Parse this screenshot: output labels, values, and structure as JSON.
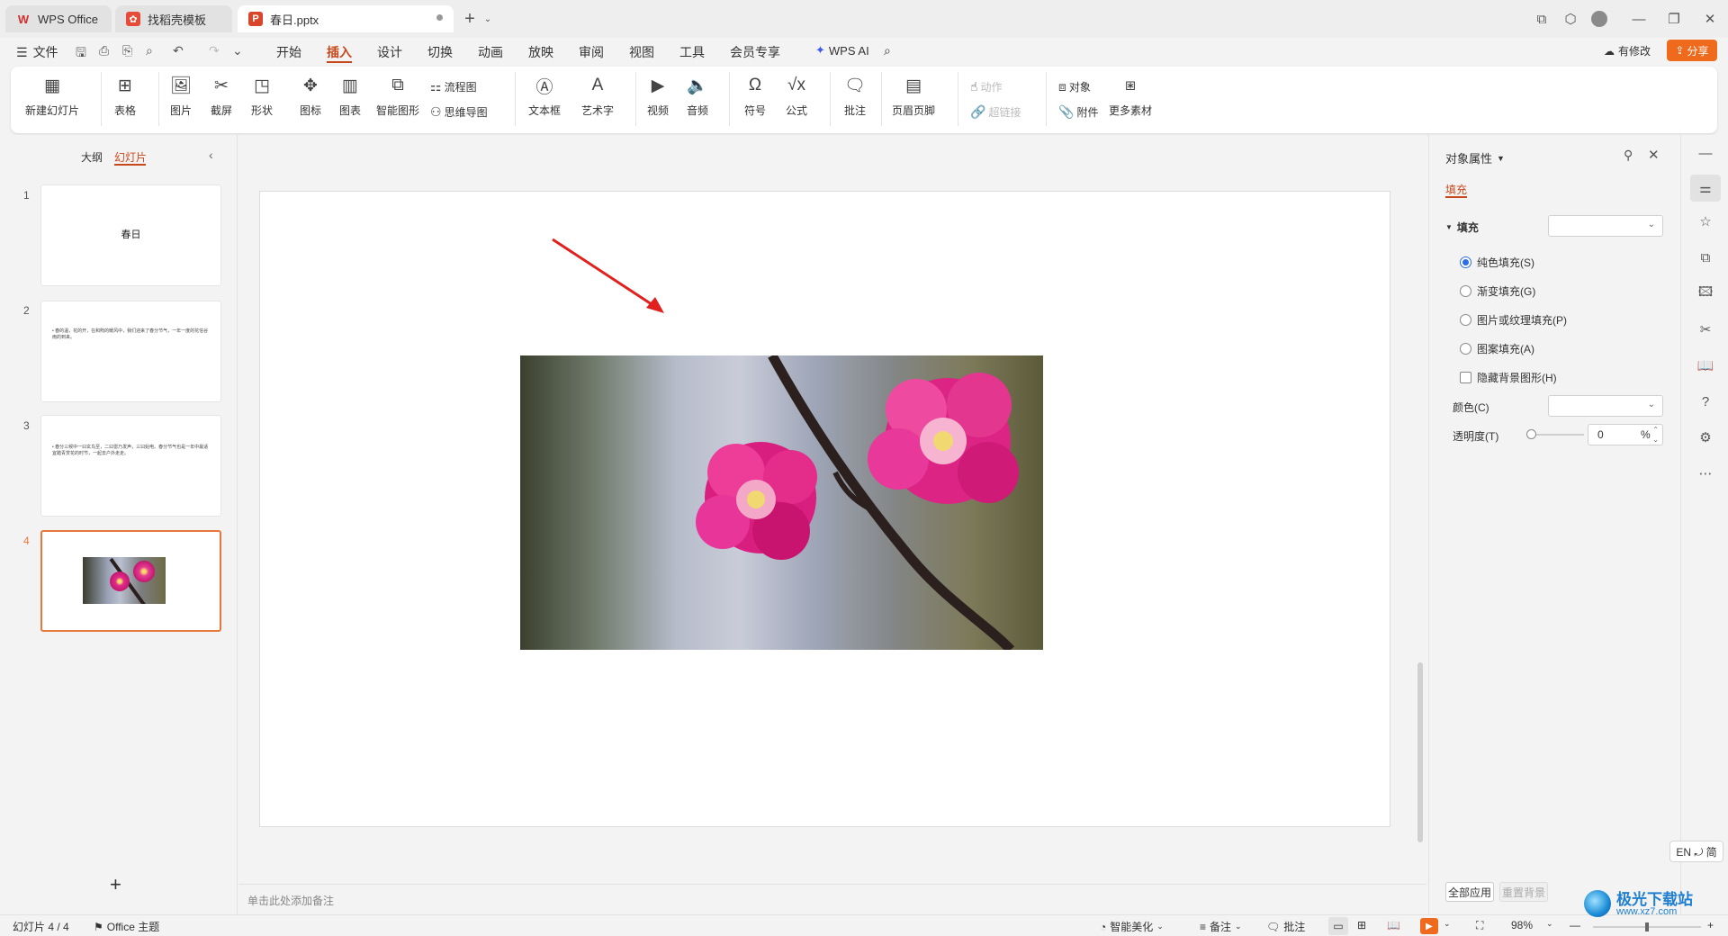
{
  "tabs": [
    {
      "label": "WPS Office",
      "icon": "wps-logo-icon"
    },
    {
      "label": "找稻壳模板",
      "icon": "docer-icon"
    },
    {
      "label": "春日.pptx",
      "icon": "ppt-file-icon"
    }
  ],
  "menu": {
    "file": "文件",
    "items": [
      "开始",
      "插入",
      "设计",
      "切换",
      "动画",
      "放映",
      "审阅",
      "视图",
      "工具",
      "会员专享"
    ],
    "active": "插入",
    "wps_ai": "WPS AI",
    "modified": "有修改",
    "share": "分享"
  },
  "ribbon": {
    "new_slide": "新建幻灯片",
    "table": "表格",
    "picture": "图片",
    "screenshot": "截屏",
    "shape": "形状",
    "icon": "图标",
    "chart": "图表",
    "smart_art": "智能图形",
    "flowchart": "流程图",
    "mindmap": "思维导图",
    "textbox": "文本框",
    "wordart": "艺术字",
    "video": "视频",
    "audio": "音频",
    "symbol": "符号",
    "formula": "公式",
    "comment": "批注",
    "header_footer": "页眉页脚",
    "action": "动作",
    "hyperlink": "超链接",
    "object": "对象",
    "attachment": "附件",
    "more_material": "更多素材"
  },
  "left_panel": {
    "outline_tab": "大纲",
    "slides_tab": "幻灯片",
    "slides": [
      {
        "num": "1",
        "title": "春日"
      },
      {
        "num": "2",
        "text": "• 春的温，花的开，在和煦的暖风中，我们迎来了春分节气，一年一度的花信谷雨的到来。"
      },
      {
        "num": "3",
        "text": "• 春分三候中一曰玄鸟至，二曰雷乃发声，三曰始电。春分节气也是一年中最适宜踏青赏花的时节，一起去户外走走。"
      },
      {
        "num": "4",
        "text": ""
      }
    ],
    "active_slide": 4,
    "add": "+"
  },
  "notes_placeholder": "单击此处添加备注",
  "right_panel": {
    "title": "对象属性",
    "tab": "填充",
    "section": "填充",
    "options": [
      "纯色填充(S)",
      "渐变填充(G)",
      "图片或纹理填充(P)",
      "图案填充(A)"
    ],
    "selected_option": 0,
    "hide_bg": "隐藏背景图形(H)",
    "color_label": "颜色(C)",
    "transparency_label": "透明度(T)",
    "transparency_value": "0",
    "percent": "%",
    "apply_all": "全部应用",
    "reset_bg": "重置背景"
  },
  "ime": "EN ⤾ 简",
  "status": {
    "slide_count": "幻灯片 4 / 4",
    "theme": "Office 主题",
    "beautify": "智能美化",
    "notes": "备注",
    "comments": "批注",
    "zoom": "98%"
  },
  "watermark": {
    "text": "极光下载站",
    "url": "www.xz7.com"
  },
  "colors": {
    "accent": "#c8481c",
    "share_btn": "#f06a1e",
    "selected_thumb": "#e8773c",
    "radio": "#2b6de8"
  }
}
